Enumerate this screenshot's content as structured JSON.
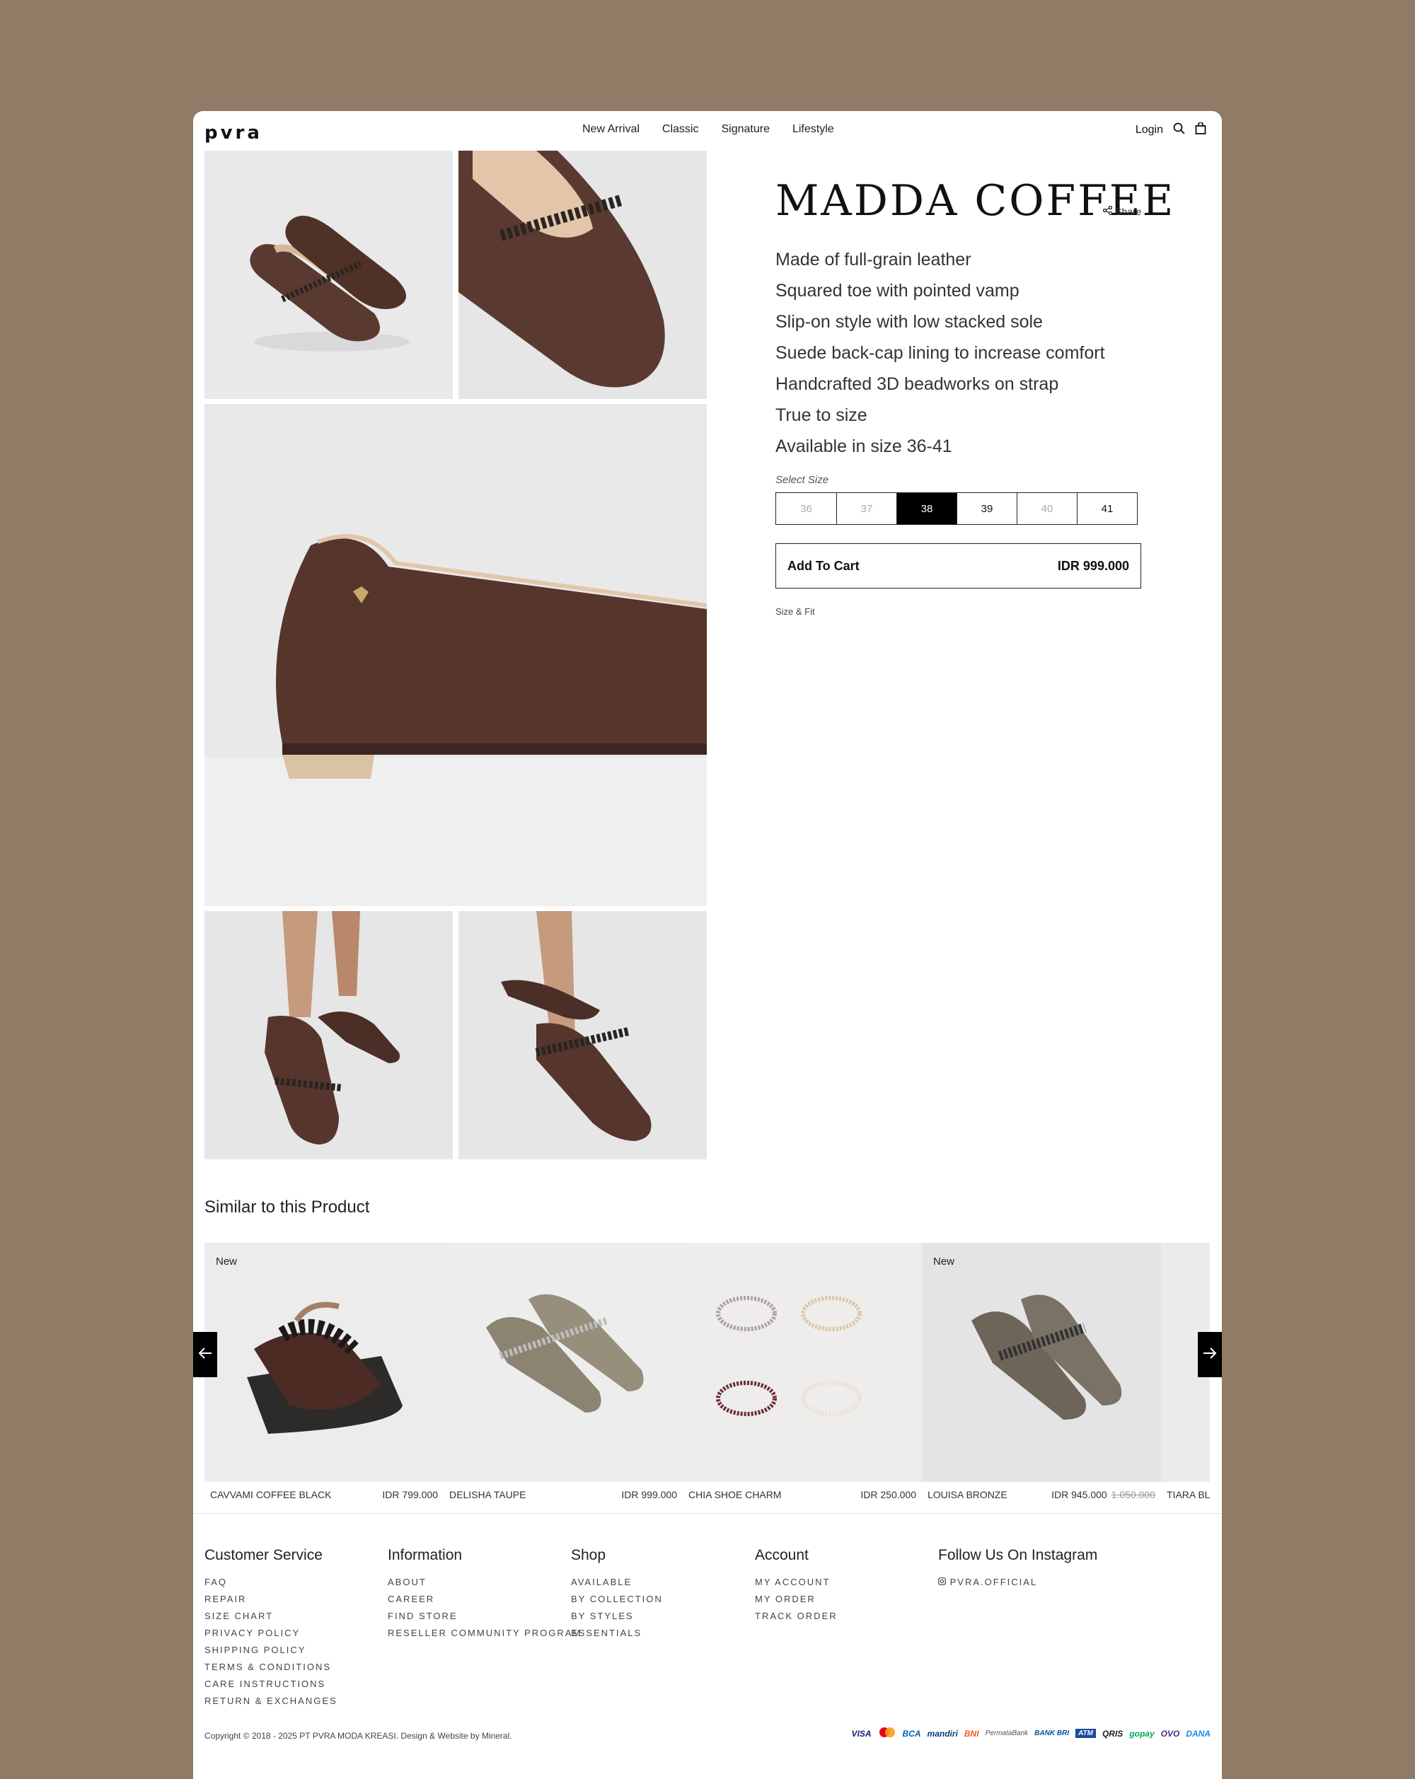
{
  "header": {
    "logo": "pvra",
    "nav": [
      "New Arrival",
      "Classic",
      "Signature",
      "Lifestyle"
    ],
    "login": "Login"
  },
  "product": {
    "name": "MADDA COFFEE",
    "share_label": "Share",
    "features": [
      "Made of full-grain leather",
      "Squared toe with pointed vamp",
      "Slip-on style with low stacked sole",
      "Suede back-cap lining to increase comfort",
      "Handcrafted 3D beadworks on strap",
      "True to size",
      "Available in size 36-41"
    ],
    "size_label": "Select Size",
    "sizes": [
      {
        "label": "36",
        "state": "unavailable"
      },
      {
        "label": "37",
        "state": "unavailable"
      },
      {
        "label": "38",
        "state": "selected"
      },
      {
        "label": "39",
        "state": "available"
      },
      {
        "label": "40",
        "state": "unavailable"
      },
      {
        "label": "41",
        "state": "available"
      }
    ],
    "cart_label": "Add To Cart",
    "price": "IDR 999.000",
    "size_fit": "Size & Fit"
  },
  "similar": {
    "title": "Similar to this Product",
    "items": [
      {
        "badge": "New",
        "name": "CAVVAMI COFFEE BLACK",
        "price": "IDR 799.000",
        "old_price": ""
      },
      {
        "badge": "",
        "name": "DELISHA TAUPE",
        "price": "IDR 999.000",
        "old_price": ""
      },
      {
        "badge": "",
        "name": "CHIA SHOE CHARM",
        "price": "IDR 250.000",
        "old_price": ""
      },
      {
        "badge": "New",
        "name": "LOUISA BRONZE",
        "price": "IDR 945.000",
        "old_price": "1.050.000"
      },
      {
        "badge": "",
        "name": "TIARA BL",
        "price": "",
        "old_price": ""
      }
    ]
  },
  "footer": {
    "customer_service": {
      "title": "Customer Service",
      "links": [
        "FAQ",
        "REPAIR",
        "SIZE CHART",
        "PRIVACY POLICY",
        "SHIPPING POLICY",
        "TERMS & CONDITIONS",
        "CARE INSTRUCTIONS",
        "RETURN & EXCHANGES"
      ]
    },
    "information": {
      "title": "Information",
      "links": [
        "ABOUT",
        "CAREER",
        "FIND STORE",
        "RESELLER COMMUNITY PROGRAM"
      ]
    },
    "shop": {
      "title": "Shop",
      "links": [
        "AVAILABLE",
        "BY COLLECTION",
        "BY STYLES",
        "ESSENTIALS"
      ]
    },
    "account": {
      "title": "Account",
      "links": [
        "MY ACCOUNT",
        "MY ORDER",
        "TRACK ORDER"
      ]
    },
    "instagram": {
      "title": "Follow Us On Instagram",
      "handle": "PVRA.OFFICIAL"
    },
    "copyright": "Copyright © 2018 - 2025 PT PVRA MODA KREASI. Design & Website by Mineral.",
    "payments": [
      "VISA",
      "mandiri",
      "BCA",
      "mandiri",
      "BNI",
      "PermataBank",
      "BANK BRI",
      "ATM",
      "QRIS",
      "gopay",
      "OVO",
      "DANA"
    ]
  },
  "colors": {
    "background": "#8f7b66",
    "leather": "#5a3a30",
    "accent": "#000000"
  }
}
